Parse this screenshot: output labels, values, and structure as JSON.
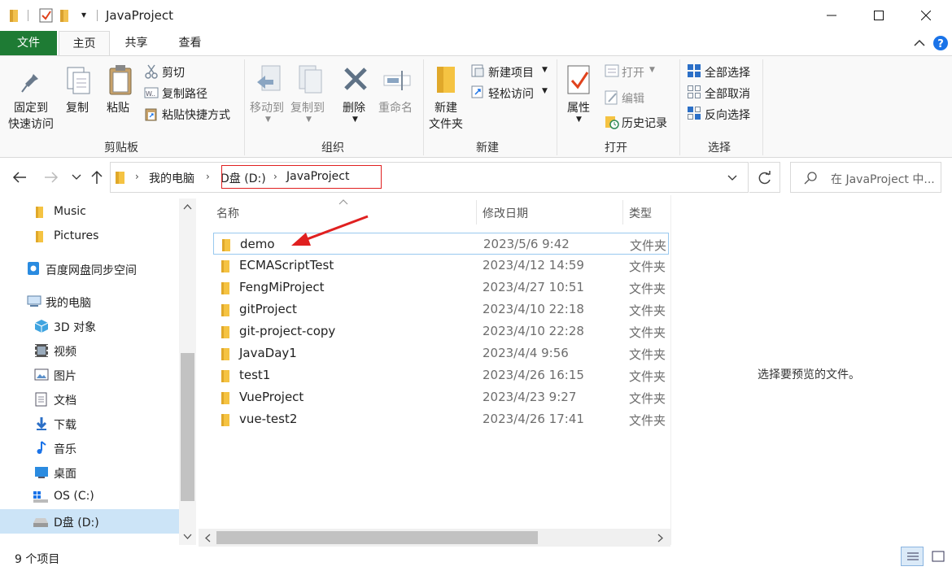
{
  "window": {
    "title": "JavaProject",
    "quick_access_dropdown": "▾"
  },
  "tabs": [
    "文件",
    "主页",
    "共享",
    "查看"
  ],
  "ribbon": {
    "clipboard": {
      "pin_l1": "固定到",
      "pin_l2": "快速访问",
      "copy": "复制",
      "paste": "粘贴",
      "cut": "剪切",
      "copy_path": "复制路径",
      "paste_shortcut": "粘贴快捷方式",
      "label": "剪贴板"
    },
    "organize": {
      "move_to": "移动到",
      "copy_to": "复制到",
      "delete": "删除",
      "rename": "重命名",
      "label": "组织"
    },
    "new": {
      "new_folder_l1": "新建",
      "new_folder_l2": "文件夹",
      "new_item": "新建项目",
      "easy_access": "轻松访问",
      "label": "新建"
    },
    "open": {
      "properties": "属性",
      "open": "打开",
      "edit": "编辑",
      "history": "历史记录",
      "label": "打开"
    },
    "select": {
      "select_all": "全部选择",
      "select_none": "全部取消",
      "invert": "反向选择",
      "label": "选择"
    }
  },
  "address": {
    "crumbs": [
      "我的电脑",
      "D盘 (D:)",
      "JavaProject"
    ],
    "search_placeholder": "在 JavaProject 中..."
  },
  "nav": {
    "items": [
      {
        "label": "Music",
        "icon": "folder-icon"
      },
      {
        "label": "Pictures",
        "icon": "folder-icon"
      },
      {
        "label": "百度网盘同步空间",
        "icon": "baidu-cloud-icon"
      },
      {
        "label": "我的电脑",
        "icon": "computer-icon"
      },
      {
        "label": "3D 对象",
        "icon": "3d-objects-icon"
      },
      {
        "label": "视频",
        "icon": "video-icon"
      },
      {
        "label": "图片",
        "icon": "pictures-icon"
      },
      {
        "label": "文档",
        "icon": "documents-icon"
      },
      {
        "label": "下载",
        "icon": "download-icon"
      },
      {
        "label": "音乐",
        "icon": "music-icon"
      },
      {
        "label": "桌面",
        "icon": "desktop-icon"
      },
      {
        "label": "OS (C:)",
        "icon": "drive-c-icon"
      },
      {
        "label": "D盘 (D:)",
        "icon": "drive-d-icon"
      }
    ]
  },
  "columns": {
    "name": "名称",
    "date": "修改日期",
    "type": "类型"
  },
  "files": [
    {
      "name": "demo",
      "date": "2023/5/6 9:42",
      "type": "文件夹"
    },
    {
      "name": "ECMAScriptTest",
      "date": "2023/4/12 14:59",
      "type": "文件夹"
    },
    {
      "name": "FengMiProject",
      "date": "2023/4/27 10:51",
      "type": "文件夹"
    },
    {
      "name": "gitProject",
      "date": "2023/4/10 22:18",
      "type": "文件夹"
    },
    {
      "name": "git-project-copy",
      "date": "2023/4/10 22:28",
      "type": "文件夹"
    },
    {
      "name": "JavaDay1",
      "date": "2023/4/4 9:56",
      "type": "文件夹"
    },
    {
      "name": "test1",
      "date": "2023/4/26 16:15",
      "type": "文件夹"
    },
    {
      "name": "VueProject",
      "date": "2023/4/23 9:27",
      "type": "文件夹"
    },
    {
      "name": "vue-test2",
      "date": "2023/4/26 17:41",
      "type": "文件夹"
    }
  ],
  "preview": {
    "text": "选择要预览的文件。"
  },
  "status": {
    "count": "9 个项目"
  },
  "colors": {
    "file_tab": "#1e7b34",
    "annotation_red": "#e02020",
    "folder": "#f5c342"
  }
}
